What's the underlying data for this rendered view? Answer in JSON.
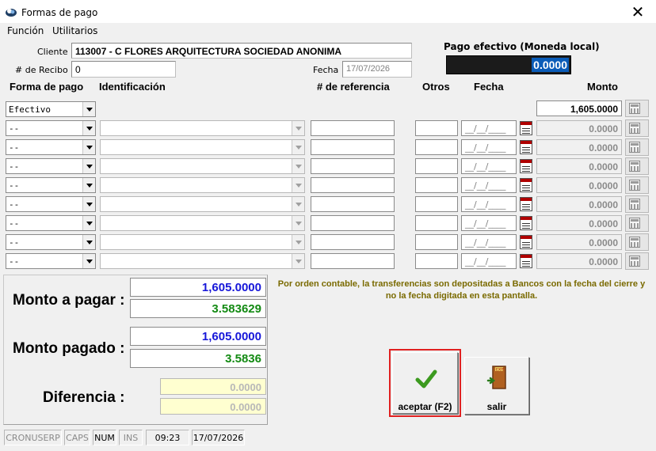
{
  "window": {
    "title": "Formas de pago",
    "close_glyph": "✕"
  },
  "menu": {
    "items": [
      "Función",
      "Utilitarios"
    ]
  },
  "header": {
    "cliente_label": "Cliente :",
    "cliente_value": "113007 - C FLORES ARQUITECTURA SOCIEDAD ANONIMA",
    "recibo_label": "# de Recibo :",
    "recibo_value": "0",
    "fecha_label": "Fecha :",
    "fecha_value": "17/07/2026",
    "pago_label": "Pago efectivo (Moneda local)",
    "pago_value": "0.0000"
  },
  "columns": {
    "forma": "Forma de pago",
    "identificacion": "Identificación",
    "referencia": "# de referencia",
    "otros": "Otros",
    "fecha": "Fecha",
    "monto": "Monto"
  },
  "rows": [
    {
      "forma": "Efectivo",
      "fecha": "",
      "monto": "1,605.0000"
    },
    {
      "forma": "--",
      "fecha": "__/__/____",
      "monto": "0.0000"
    },
    {
      "forma": "--",
      "fecha": "__/__/____",
      "monto": "0.0000"
    },
    {
      "forma": "--",
      "fecha": "__/__/____",
      "monto": "0.0000"
    },
    {
      "forma": "--",
      "fecha": "__/__/____",
      "monto": "0.0000"
    },
    {
      "forma": "--",
      "fecha": "__/__/____",
      "monto": "0.0000"
    },
    {
      "forma": "--",
      "fecha": "__/__/____",
      "monto": "0.0000"
    },
    {
      "forma": "--",
      "fecha": "__/__/____",
      "monto": "0.0000"
    },
    {
      "forma": "--",
      "fecha": "__/__/____",
      "monto": "0.0000"
    }
  ],
  "totals": {
    "monto_pagar_label": "Monto a pagar :",
    "monto_pagar_local": "1,605.0000",
    "monto_pagar_alt": "3.583629",
    "monto_pagado_label": "Monto pagado :",
    "monto_pagado_local": "1,605.0000",
    "monto_pagado_alt": "3.5836",
    "diferencia_label": "Diferencia :",
    "diferencia_local": "0.0000",
    "diferencia_alt": "0.0000"
  },
  "note": "Por orden contable, la transferencias son depositadas a Bancos con la fecha del cierre y no la fecha digitada en esta pantalla.",
  "buttons": {
    "aceptar": "aceptar (F2)",
    "salir": "salir"
  },
  "icons": {
    "aceptar": "checkmark-icon",
    "salir": "exit-door-icon"
  },
  "statusbar": [
    "CRONUSERP",
    "CAPS",
    "NUM",
    "INS",
    "09:23",
    "17/07/2026"
  ],
  "colors": {
    "blue_value": "#1717d9",
    "green_value": "#138a13",
    "highlight": "#0a5cb8",
    "note": "#7a6a00",
    "frame": "#e02020"
  }
}
